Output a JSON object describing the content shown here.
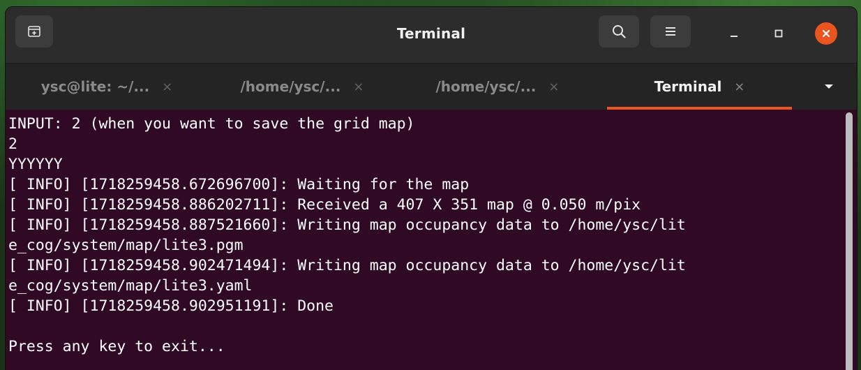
{
  "window": {
    "title": "Terminal"
  },
  "tabs": [
    {
      "label": "ysc@lite: ~/...",
      "close": "×",
      "active": false
    },
    {
      "label": "/home/ysc/...",
      "close": "×",
      "active": false
    },
    {
      "label": "/home/ysc/...",
      "close": "×",
      "active": false
    },
    {
      "label": "Terminal",
      "close": "×",
      "active": true
    }
  ],
  "icons": {
    "new_tab": "new-tab-icon",
    "search": "search-icon",
    "menu": "hamburger-menu-icon",
    "minimize": "minimize-icon",
    "maximize": "maximize-icon",
    "close": "close-icon",
    "tabs_dropdown": "chevron-down-icon"
  },
  "colors": {
    "terminal_background": "#300a24",
    "terminal_text": "#ffffff",
    "accent": "#e95420",
    "titlebar": "#2c2c2c",
    "tabbar": "#242424"
  },
  "terminal": {
    "lines": [
      "INPUT: 2 (when you want to save the grid map)",
      "2",
      "YYYYYY",
      "[ INFO] [1718259458.672696700]: Waiting for the map",
      "[ INFO] [1718259458.886202711]: Received a 407 X 351 map @ 0.050 m/pix",
      "[ INFO] [1718259458.887521660]: Writing map occupancy data to /home/ysc/lit",
      "e_cog/system/map/lite3.pgm",
      "[ INFO] [1718259458.902471494]: Writing map occupancy data to /home/ysc/lit",
      "e_cog/system/map/lite3.yaml",
      "[ INFO] [1718259458.902951191]: Done",
      "",
      "Press any key to exit..."
    ]
  }
}
